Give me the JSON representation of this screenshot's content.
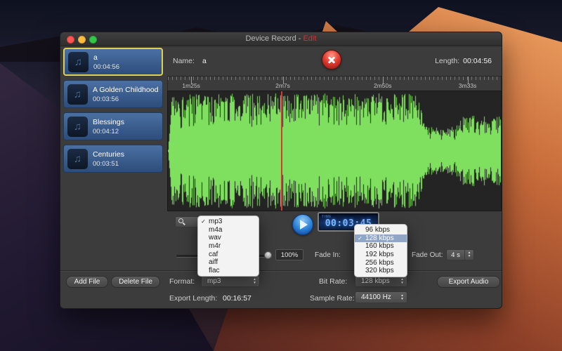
{
  "colors": {
    "waveform": "#7fe05f",
    "playhead": "#d23b2e",
    "title_edit": "#cc3333",
    "lcd_digits": "#7db4ff",
    "selected_item_border": "#e0d050"
  },
  "window": {
    "title_prefix": "Device Record - ",
    "title_suffix": "Edit"
  },
  "sidebar": {
    "items": [
      {
        "name": "a",
        "duration": "00:04:56"
      },
      {
        "name": "A Golden Childhood",
        "duration": "00:03:56"
      },
      {
        "name": "Blessings",
        "duration": "00:04:12"
      },
      {
        "name": "Centuries",
        "duration": "00:03:51"
      }
    ]
  },
  "editor": {
    "name_label": "Name:",
    "name_value": "a",
    "length_label": "Length:",
    "length_value": "00:04:56",
    "ruler": [
      "1m25s",
      "2m7s",
      "2m50s",
      "3m33s"
    ],
    "time": {
      "label": "TIME",
      "value": "00:03:45"
    },
    "zoom_value": "100%",
    "fade_in_label": "Fade In:",
    "fade_out_label": "Fade Out:",
    "fade_out_value": "4 s"
  },
  "menus": {
    "format": {
      "items": [
        {
          "check": "✓",
          "label": "mp3"
        },
        {
          "check": "",
          "label": "m4a"
        },
        {
          "check": "",
          "label": "wav"
        },
        {
          "check": "",
          "label": "m4r"
        },
        {
          "check": "",
          "label": "caf"
        },
        {
          "check": "",
          "label": "aiff"
        },
        {
          "check": "",
          "label": "flac"
        }
      ]
    },
    "bitrate": {
      "items": [
        {
          "check": "",
          "label": "96 kbps"
        },
        {
          "check": "✓",
          "label": "128 kbps"
        },
        {
          "check": "",
          "label": "160 kbps"
        },
        {
          "check": "",
          "label": "192 kbps"
        },
        {
          "check": "",
          "label": "256 kbps"
        },
        {
          "check": "",
          "label": "320 kbps"
        }
      ]
    }
  },
  "footer": {
    "add_file": "Add File",
    "delete_file": "Delete File",
    "format_label": "Format:",
    "format_value": "mp3",
    "bitrate_label": "Bit Rate:",
    "bitrate_value": "128 kbps",
    "export_audio": "Export Audio",
    "export_length_label": "Export Length:",
    "export_length_value": "00:16:57",
    "sample_rate_label": "Sample Rate:",
    "sample_rate_value": "44100 Hz"
  }
}
